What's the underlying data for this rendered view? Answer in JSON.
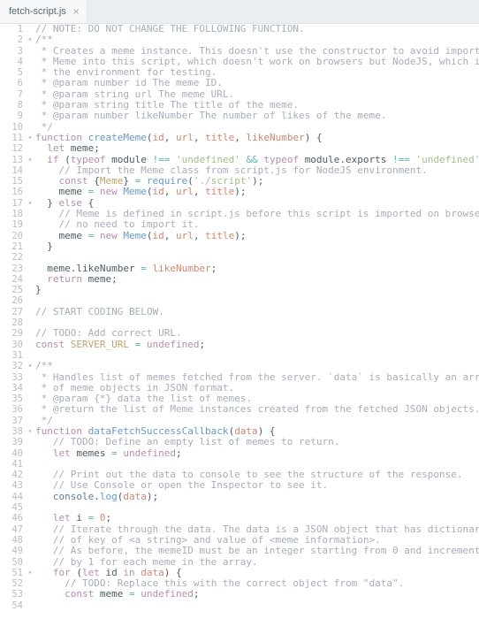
{
  "tab": {
    "filename": "fetch-script.js",
    "close": "×"
  },
  "lines": [
    {
      "n": 1,
      "fold": "",
      "tokens": [
        [
          "c-comment",
          "// NOTE: DO NOT CHANGE THE FOLLOWING FUNCTION."
        ]
      ]
    },
    {
      "n": 2,
      "fold": "▾",
      "tokens": [
        [
          "c-comment",
          "/**"
        ]
      ]
    },
    {
      "n": 3,
      "fold": "",
      "tokens": [
        [
          "c-comment",
          " * Creates a meme instance. This doesn't use the constructor to avoid importing"
        ]
      ]
    },
    {
      "n": 4,
      "fold": "",
      "tokens": [
        [
          "c-comment",
          " * Meme into this script, which doesn't work on browsers but NodeJS, which is"
        ]
      ]
    },
    {
      "n": 5,
      "fold": "",
      "tokens": [
        [
          "c-comment",
          " * the environment for testing."
        ]
      ]
    },
    {
      "n": 6,
      "fold": "",
      "tokens": [
        [
          "c-comment",
          " * @param number id The meme ID."
        ]
      ]
    },
    {
      "n": 7,
      "fold": "",
      "tokens": [
        [
          "c-comment",
          " * @param string url The meme URL."
        ]
      ]
    },
    {
      "n": 8,
      "fold": "",
      "tokens": [
        [
          "c-comment",
          " * @param string title The title of the meme."
        ]
      ]
    },
    {
      "n": 9,
      "fold": "",
      "tokens": [
        [
          "c-comment",
          " * @param number likeNumber The number of likes of the meme."
        ]
      ]
    },
    {
      "n": 10,
      "fold": "",
      "tokens": [
        [
          "c-comment",
          " */"
        ]
      ]
    },
    {
      "n": 11,
      "fold": "▾",
      "tokens": [
        [
          "c-kw",
          "function "
        ],
        [
          "c-fn",
          "createMeme"
        ],
        [
          "c-plain",
          "("
        ],
        [
          "c-param",
          "id"
        ],
        [
          "c-plain",
          ", "
        ],
        [
          "c-param",
          "url"
        ],
        [
          "c-plain",
          ", "
        ],
        [
          "c-param",
          "title"
        ],
        [
          "c-plain",
          ", "
        ],
        [
          "c-param",
          "likeNumber"
        ],
        [
          "c-plain",
          ") {"
        ]
      ]
    },
    {
      "n": 12,
      "fold": "",
      "tokens": [
        [
          "c-plain",
          "  "
        ],
        [
          "c-kw",
          "let "
        ],
        [
          "c-plain",
          "meme;"
        ]
      ]
    },
    {
      "n": 13,
      "fold": "▾",
      "tokens": [
        [
          "c-plain",
          "  "
        ],
        [
          "c-kw",
          "if "
        ],
        [
          "c-plain",
          "("
        ],
        [
          "c-kw",
          "typeof "
        ],
        [
          "c-plain",
          "module "
        ],
        [
          "c-op",
          "!== "
        ],
        [
          "c-str",
          "'undefined'"
        ],
        [
          "c-plain",
          " "
        ],
        [
          "c-op",
          "&&"
        ],
        [
          "c-plain",
          " "
        ],
        [
          "c-kw",
          "typeof "
        ],
        [
          "c-plain",
          "module.exports "
        ],
        [
          "c-op",
          "!== "
        ],
        [
          "c-str",
          "'undefined'"
        ],
        [
          "c-plain",
          ") {"
        ]
      ]
    },
    {
      "n": 14,
      "fold": "",
      "tokens": [
        [
          "c-plain",
          "    "
        ],
        [
          "c-comment",
          "// Import the Meme class from script.js for NodeJS environment."
        ]
      ]
    },
    {
      "n": 15,
      "fold": "",
      "tokens": [
        [
          "c-plain",
          "    "
        ],
        [
          "c-kw",
          "const "
        ],
        [
          "c-plain",
          "{"
        ],
        [
          "c-var",
          "Meme"
        ],
        [
          "c-plain",
          "} "
        ],
        [
          "c-op",
          "= "
        ],
        [
          "c-fn",
          "require"
        ],
        [
          "c-plain",
          "("
        ],
        [
          "c-str",
          "'./script'"
        ],
        [
          "c-plain",
          ");"
        ]
      ]
    },
    {
      "n": 16,
      "fold": "",
      "tokens": [
        [
          "c-plain",
          "    meme "
        ],
        [
          "c-op",
          "= "
        ],
        [
          "c-kw",
          "new "
        ],
        [
          "c-fn",
          "Meme"
        ],
        [
          "c-plain",
          "("
        ],
        [
          "c-param",
          "id"
        ],
        [
          "c-plain",
          ", "
        ],
        [
          "c-param",
          "url"
        ],
        [
          "c-plain",
          ", "
        ],
        [
          "c-param",
          "title"
        ],
        [
          "c-plain",
          ");"
        ]
      ]
    },
    {
      "n": 17,
      "fold": "▾",
      "tokens": [
        [
          "c-plain",
          "  } "
        ],
        [
          "c-kw",
          "else"
        ],
        [
          "c-plain",
          " {"
        ]
      ]
    },
    {
      "n": 18,
      "fold": "",
      "tokens": [
        [
          "c-plain",
          "    "
        ],
        [
          "c-comment",
          "// Meme is defined in script.js before this script is imported on browsers so"
        ]
      ]
    },
    {
      "n": 19,
      "fold": "",
      "tokens": [
        [
          "c-plain",
          "    "
        ],
        [
          "c-comment",
          "// no need to import it."
        ]
      ]
    },
    {
      "n": 20,
      "fold": "",
      "tokens": [
        [
          "c-plain",
          "    meme "
        ],
        [
          "c-op",
          "= "
        ],
        [
          "c-kw",
          "new "
        ],
        [
          "c-fn",
          "Meme"
        ],
        [
          "c-plain",
          "("
        ],
        [
          "c-param",
          "id"
        ],
        [
          "c-plain",
          ", "
        ],
        [
          "c-param",
          "url"
        ],
        [
          "c-plain",
          ", "
        ],
        [
          "c-param",
          "title"
        ],
        [
          "c-plain",
          ");"
        ]
      ]
    },
    {
      "n": 21,
      "fold": "",
      "tokens": [
        [
          "c-plain",
          "  }"
        ]
      ]
    },
    {
      "n": 22,
      "fold": "",
      "tokens": [
        [
          "c-plain",
          ""
        ]
      ]
    },
    {
      "n": 23,
      "fold": "",
      "tokens": [
        [
          "c-plain",
          "  meme.likeNumber "
        ],
        [
          "c-op",
          "= "
        ],
        [
          "c-param",
          "likeNumber"
        ],
        [
          "c-plain",
          ";"
        ]
      ]
    },
    {
      "n": 24,
      "fold": "",
      "tokens": [
        [
          "c-plain",
          "  "
        ],
        [
          "c-kw",
          "return "
        ],
        [
          "c-plain",
          "meme;"
        ]
      ]
    },
    {
      "n": 25,
      "fold": "",
      "tokens": [
        [
          "c-plain",
          "}"
        ]
      ]
    },
    {
      "n": 26,
      "fold": "",
      "tokens": [
        [
          "c-plain",
          ""
        ]
      ]
    },
    {
      "n": 27,
      "fold": "",
      "tokens": [
        [
          "c-comment",
          "// START CODING BELOW."
        ]
      ]
    },
    {
      "n": 28,
      "fold": "",
      "tokens": [
        [
          "c-plain",
          ""
        ]
      ]
    },
    {
      "n": 29,
      "fold": "",
      "tokens": [
        [
          "c-comment",
          "// TODO: Add correct URL."
        ]
      ]
    },
    {
      "n": 30,
      "fold": "",
      "tokens": [
        [
          "c-kw",
          "const "
        ],
        [
          "c-var",
          "SERVER_URL"
        ],
        [
          "c-plain",
          " "
        ],
        [
          "c-op",
          "= "
        ],
        [
          "c-kw2",
          "undefined"
        ],
        [
          "c-plain",
          ";"
        ]
      ]
    },
    {
      "n": 31,
      "fold": "",
      "tokens": [
        [
          "c-plain",
          ""
        ]
      ]
    },
    {
      "n": 32,
      "fold": "▾",
      "tokens": [
        [
          "c-comment",
          "/**"
        ]
      ]
    },
    {
      "n": 33,
      "fold": "",
      "tokens": [
        [
          "c-comment",
          " * Handles list of memes fetched from the server. `data` is basically an array"
        ]
      ]
    },
    {
      "n": 34,
      "fold": "",
      "tokens": [
        [
          "c-comment",
          " * of meme objects in JSON format."
        ]
      ]
    },
    {
      "n": 35,
      "fold": "",
      "tokens": [
        [
          "c-comment",
          " * @param {*} data the list of memes."
        ]
      ]
    },
    {
      "n": 36,
      "fold": "",
      "tokens": [
        [
          "c-comment",
          " * @return the list of Meme instances created from the fetched JSON objects."
        ]
      ]
    },
    {
      "n": 37,
      "fold": "",
      "tokens": [
        [
          "c-comment",
          " */"
        ]
      ]
    },
    {
      "n": 38,
      "fold": "▾",
      "tokens": [
        [
          "c-kw",
          "function "
        ],
        [
          "c-fn",
          "dataFetchSuccessCallback"
        ],
        [
          "c-plain",
          "("
        ],
        [
          "c-param",
          "data"
        ],
        [
          "c-plain",
          ") {"
        ]
      ]
    },
    {
      "n": 39,
      "fold": "",
      "tokens": [
        [
          "c-plain",
          "   "
        ],
        [
          "c-comment",
          "// TODO: Define an empty list of memes to return."
        ]
      ]
    },
    {
      "n": 40,
      "fold": "",
      "tokens": [
        [
          "c-plain",
          "   "
        ],
        [
          "c-kw",
          "let "
        ],
        [
          "c-plain",
          "memes "
        ],
        [
          "c-op",
          "= "
        ],
        [
          "c-kw2",
          "undefined"
        ],
        [
          "c-plain",
          ";"
        ]
      ]
    },
    {
      "n": 41,
      "fold": "",
      "tokens": [
        [
          "c-plain",
          ""
        ]
      ]
    },
    {
      "n": 42,
      "fold": "",
      "tokens": [
        [
          "c-plain",
          "   "
        ],
        [
          "c-comment",
          "// Print out the data to console to see the structure of the response."
        ]
      ]
    },
    {
      "n": 43,
      "fold": "",
      "tokens": [
        [
          "c-plain",
          "   "
        ],
        [
          "c-comment",
          "// Use Console or open the Inspector to see it."
        ]
      ]
    },
    {
      "n": 44,
      "fold": "",
      "tokens": [
        [
          "c-plain",
          "   "
        ],
        [
          "c-obj",
          "console"
        ],
        [
          "c-plain",
          "."
        ],
        [
          "c-fn",
          "log"
        ],
        [
          "c-plain",
          "("
        ],
        [
          "c-param",
          "data"
        ],
        [
          "c-plain",
          ");"
        ]
      ]
    },
    {
      "n": 45,
      "fold": "",
      "tokens": [
        [
          "c-plain",
          ""
        ]
      ]
    },
    {
      "n": 46,
      "fold": "",
      "tokens": [
        [
          "c-plain",
          "   "
        ],
        [
          "c-kw",
          "let "
        ],
        [
          "c-plain",
          "i "
        ],
        [
          "c-op",
          "= "
        ],
        [
          "c-param",
          "0"
        ],
        [
          "c-plain",
          ";"
        ]
      ]
    },
    {
      "n": 47,
      "fold": "",
      "tokens": [
        [
          "c-plain",
          "   "
        ],
        [
          "c-comment",
          "// Iterate through the data. The data is a JSON object that has dictionary"
        ]
      ]
    },
    {
      "n": 48,
      "fold": "",
      "tokens": [
        [
          "c-plain",
          "   "
        ],
        [
          "c-comment",
          "// of key of <a string> and value of <meme information>."
        ]
      ]
    },
    {
      "n": 49,
      "fold": "",
      "tokens": [
        [
          "c-plain",
          "   "
        ],
        [
          "c-comment",
          "// As before, the memeID must be an integer starting from 0 and incremented"
        ]
      ]
    },
    {
      "n": 50,
      "fold": "",
      "tokens": [
        [
          "c-plain",
          "   "
        ],
        [
          "c-comment",
          "// by 1 for each meme in the array."
        ]
      ]
    },
    {
      "n": 51,
      "fold": "▾",
      "tokens": [
        [
          "c-plain",
          "   "
        ],
        [
          "c-kw",
          "for "
        ],
        [
          "c-plain",
          "("
        ],
        [
          "c-kw",
          "let "
        ],
        [
          "c-plain",
          "id "
        ],
        [
          "c-kw",
          "in "
        ],
        [
          "c-param",
          "data"
        ],
        [
          "c-plain",
          ") {"
        ]
      ]
    },
    {
      "n": 52,
      "fold": "",
      "tokens": [
        [
          "c-plain",
          "     "
        ],
        [
          "c-comment",
          "// TODO: Replace this with the correct object from \"data\"."
        ]
      ]
    },
    {
      "n": 53,
      "fold": "",
      "tokens": [
        [
          "c-plain",
          "     "
        ],
        [
          "c-kw",
          "const "
        ],
        [
          "c-plain",
          "meme "
        ],
        [
          "c-op",
          "= "
        ],
        [
          "c-kw2",
          "undefined"
        ],
        [
          "c-plain",
          ";"
        ]
      ]
    },
    {
      "n": 54,
      "fold": "",
      "tokens": [
        [
          "c-plain",
          ""
        ]
      ]
    }
  ]
}
